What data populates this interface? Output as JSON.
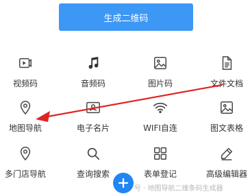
{
  "generate_button": {
    "label": "生成二维码",
    "color": "#3d97f5"
  },
  "tools": [
    {
      "id": "video",
      "label": "视频码",
      "icon": "video-file-icon"
    },
    {
      "id": "audio",
      "label": "音频码",
      "icon": "music-note-icon"
    },
    {
      "id": "image",
      "label": "图片码",
      "icon": "image-icon"
    },
    {
      "id": "doc",
      "label": "文件文档",
      "icon": "document-icon"
    },
    {
      "id": "map",
      "label": "地图导航",
      "icon": "location-pin-icon"
    },
    {
      "id": "card",
      "label": "电子名片",
      "icon": "business-card-icon"
    },
    {
      "id": "wifi",
      "label": "WIFI自连",
      "icon": "wifi-icon"
    },
    {
      "id": "imgtable",
      "label": "图文表格",
      "icon": "image-table-icon"
    },
    {
      "id": "multistore",
      "label": "多门店导航",
      "icon": "location-pin-icon"
    },
    {
      "id": "search",
      "label": "查询搜索",
      "icon": "search-icon"
    },
    {
      "id": "form",
      "label": "表单登记",
      "icon": "grid-form-icon"
    },
    {
      "id": "editor",
      "label": "高级编辑器",
      "icon": "pen-edit-icon"
    }
  ],
  "annotation": {
    "color": "#e02424"
  },
  "fab": {
    "label": "+",
    "color": "#1f86f2"
  },
  "watermark": {
    "text": "号 · 地图导航二维条码生成器"
  }
}
